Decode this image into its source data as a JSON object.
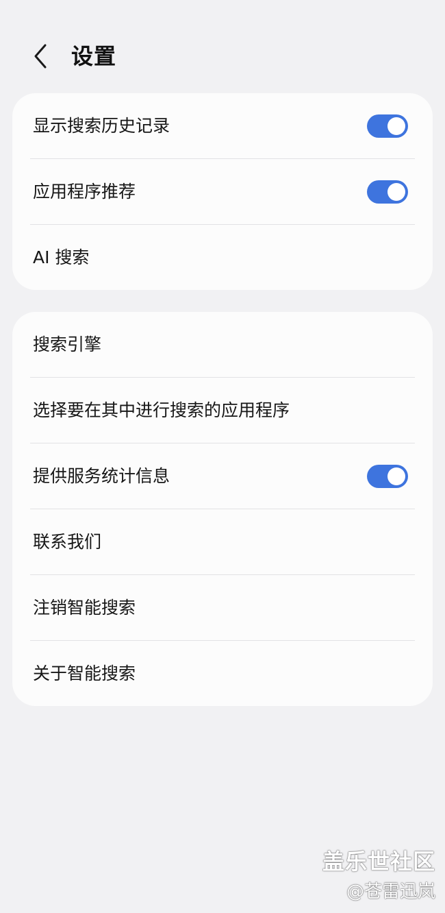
{
  "header": {
    "title": "设置",
    "back_icon": "chevron-left-icon"
  },
  "colors": {
    "background": "#f1f1f3",
    "card": "#fcfcfc",
    "toggle_on": "#3e74de",
    "divider": "#e2e2e4"
  },
  "group1": {
    "items": [
      {
        "label": "显示搜索历史记录",
        "toggle": true
      },
      {
        "label": "应用程序推荐",
        "toggle": true
      },
      {
        "label": "AI 搜索"
      }
    ]
  },
  "group2": {
    "items": [
      {
        "label": "搜索引擎"
      },
      {
        "label": "选择要在其中进行搜索的应用程序"
      },
      {
        "label": "提供服务统计信息",
        "toggle": true
      },
      {
        "label": "联系我们"
      },
      {
        "label": "注销智能搜索"
      },
      {
        "label": "关于智能搜索"
      }
    ]
  },
  "watermark": {
    "line1": "盖乐世社区",
    "line2": "@苍雷迅岚"
  }
}
